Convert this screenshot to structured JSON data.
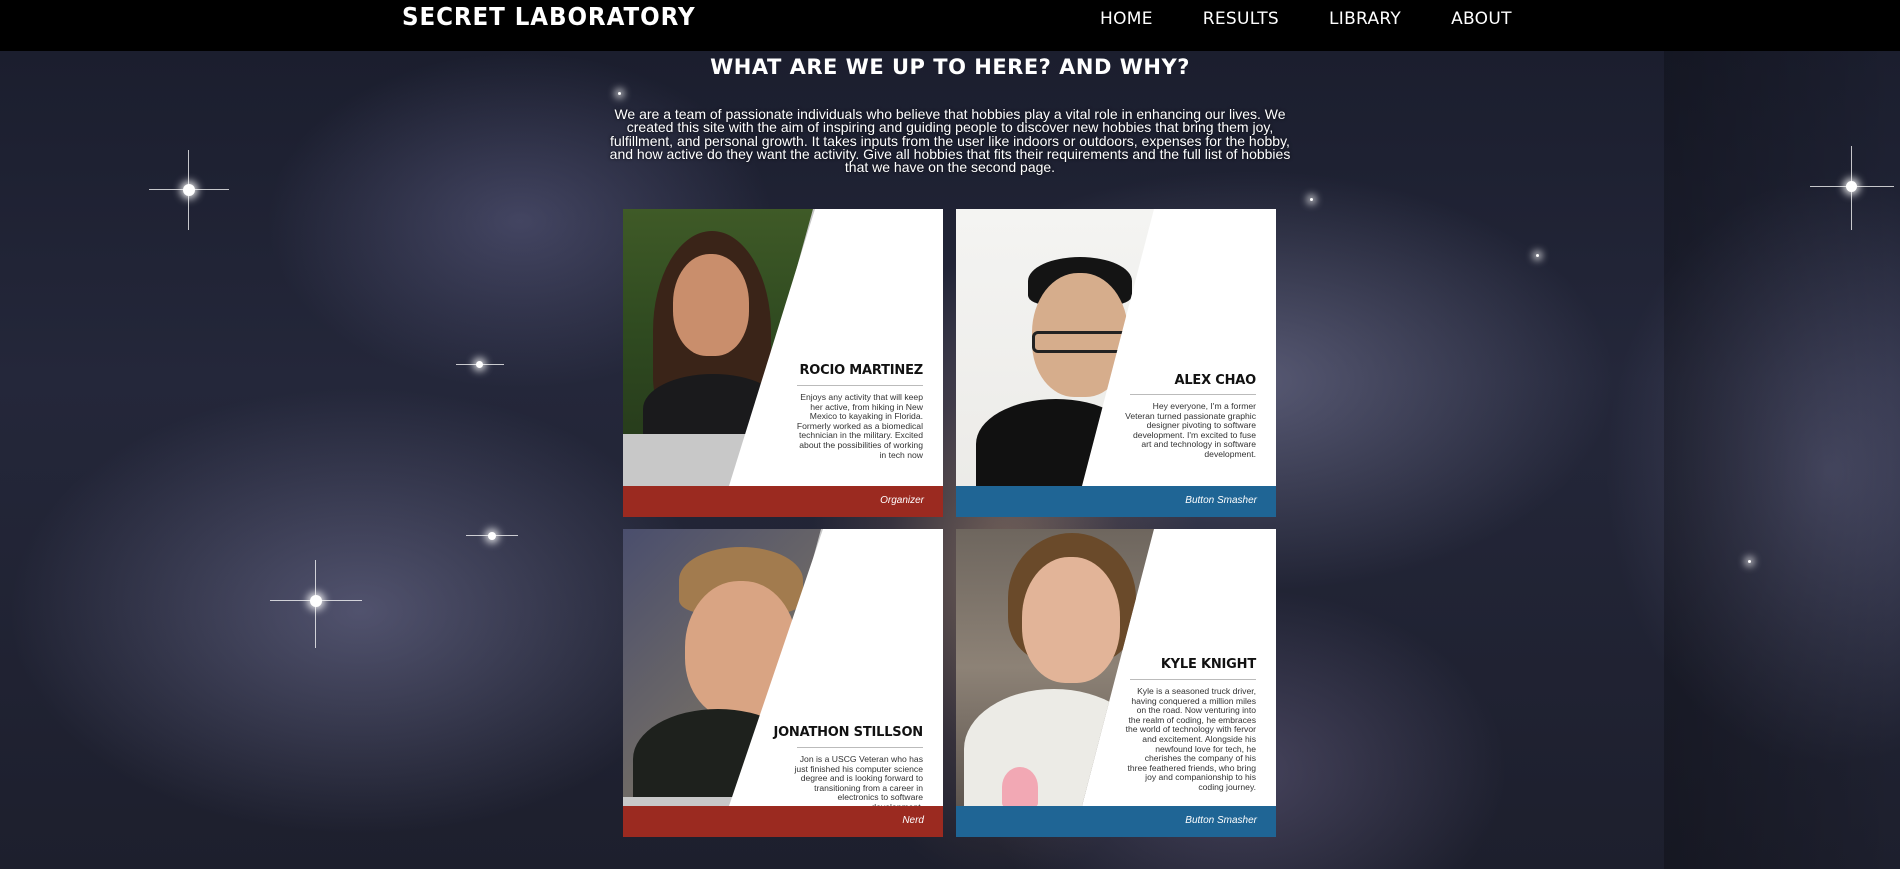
{
  "site": {
    "logo": "Secret Laboratory"
  },
  "nav": [
    "HOME",
    "RESULTS",
    "LIBRARY",
    "ABOUT"
  ],
  "intro": {
    "heading": "What are we up to here? And why?",
    "body": "We are a team of passionate individuals who believe that hobbies play a vital role in enhancing our lives. We created this site with the aim of inspiring and guiding people to discover new hobbies that bring them joy, fulfillment, and personal growth. It takes inputs from the user like indoors or outdoors, expenses for the hobby, and how active do they want the activity. Give all hobbies that fits their requirements and the full list of hobbies that we have on the second page."
  },
  "team": [
    {
      "name": "Rocio Martinez",
      "bio": "Enjoys any activity that will keep her active, from hiking in New Mexico to kayaking in Florida. Formerly worked as a biomedical technician in the military. Excited about the possibilities of working in tech now",
      "role": "Organizer",
      "role_color": "#9b2a20"
    },
    {
      "name": "Alex Chao",
      "bio": "Hey everyone, I'm a former Veteran turned passionate graphic designer pivoting to software development. I'm excited to fuse art and technology in software development.",
      "role": "Button Smasher",
      "role_color": "#1f6595"
    },
    {
      "name": "Jonathon Stillson",
      "bio": "Jon is a USCG Veteran who has just finished his computer science degree and is looking forward to transitioning from a career in electronics to software development.",
      "role": "Nerd",
      "role_color": "#9b2a20"
    },
    {
      "name": "Kyle Knight",
      "bio": "Kyle is a seasoned truck driver, having conquered a million miles on the road. Now venturing into the realm of coding, he embraces the world of technology with fervor and excitement. Alongside his newfound love for tech, he cherishes the company of his three feathered friends, who bring joy and companionship to his coding journey.",
      "role": "Button Smasher",
      "role_color": "#1f6595"
    }
  ]
}
